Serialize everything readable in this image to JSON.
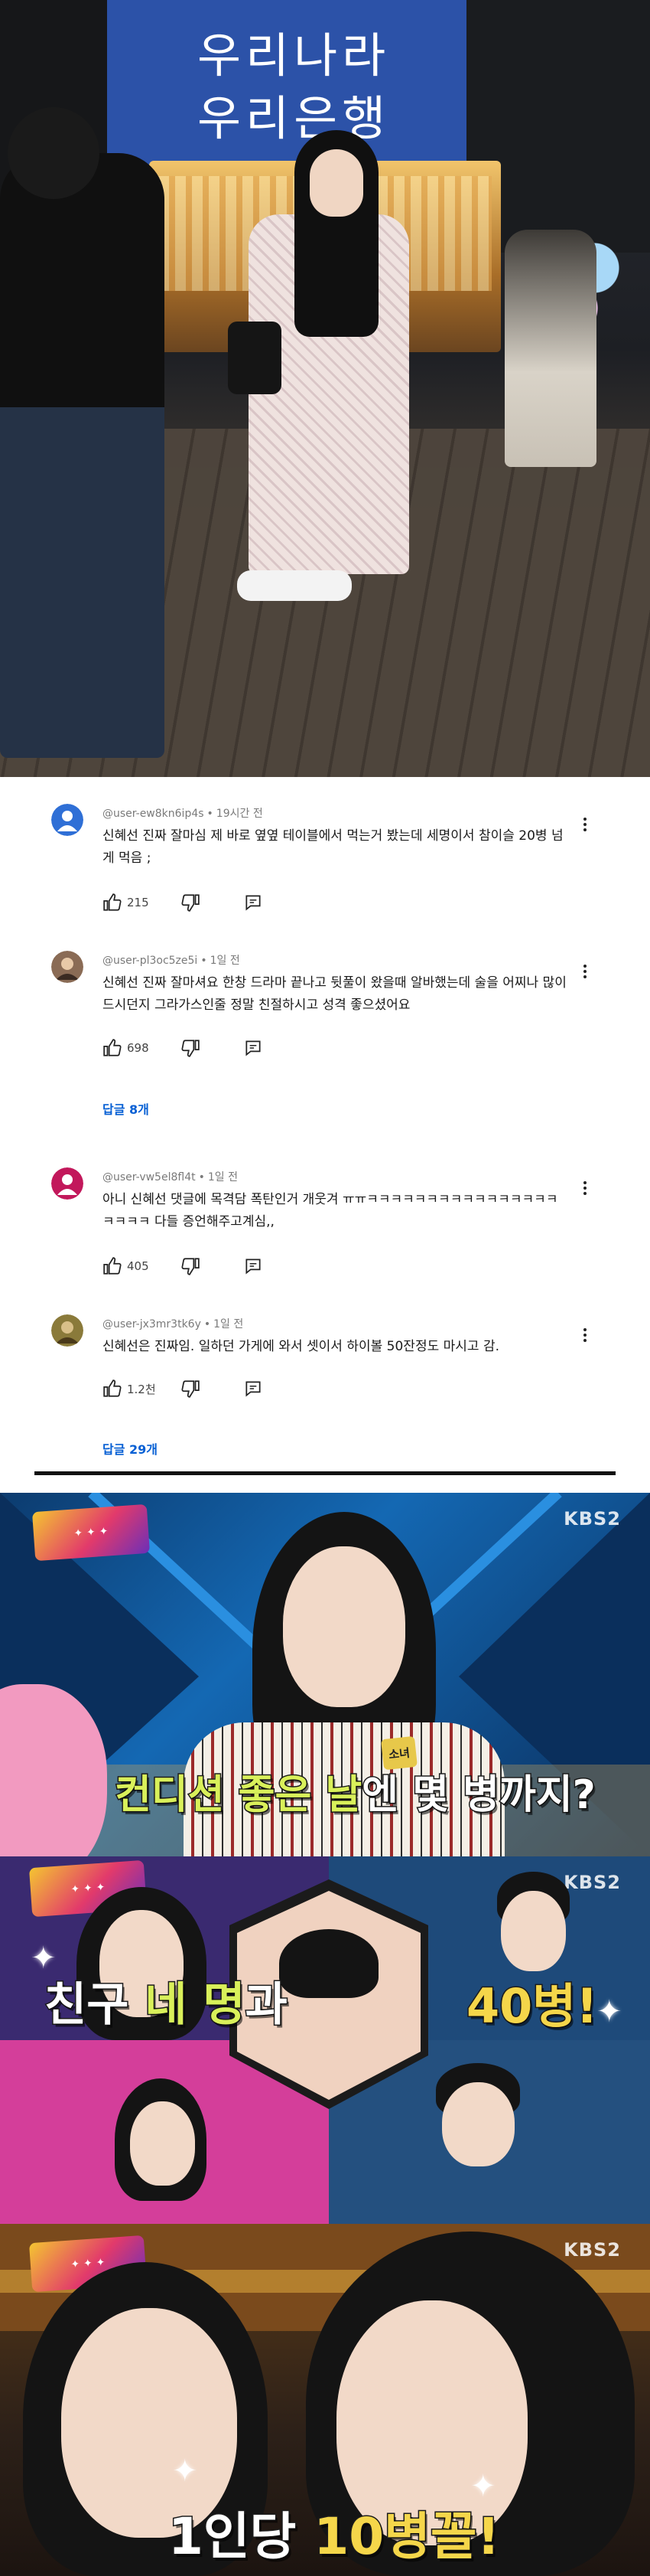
{
  "photo": {
    "sign_line1": "우리나라",
    "sign_line2": "우리은행"
  },
  "comments": [
    {
      "username": "@user-ew8kn6ip4s",
      "time": "19시간 전",
      "text": "신혜선 진짜 잘마심 제 바로 옆옆 테이블에서 먹는거 봤는데 세명이서 참이슬 20병 넘게 먹음 ;",
      "likes": "215",
      "avatar_color": "#2f6fd6",
      "replies_label": ""
    },
    {
      "username": "@user-pl3oc5ze5i",
      "time": "1일 전",
      "text": "신혜선 진짜 잘마셔요 한창 드라마 끝나고 뒷풀이 왔을때 알바했는데 술을 어찌나 많이드시던지 그라가스인줄 정말 친절하시고 성격 좋으셨어요",
      "likes": "698",
      "avatar_color": "#8a6b55",
      "replies_label": "답글 8개"
    },
    {
      "username": "@user-vw5el8fl4t",
      "time": "1일 전",
      "text": "아니 신혜선 댓글에 목격담 폭탄인거 개웃겨 ㅠㅠㅋㅋㅋㅋㅋㅋㅋㅋㅋㅋㅋㅋㅋㅋㅋㅋㅋㅋㅋㅋ 다들 증언해주고계심,,",
      "likes": "405",
      "avatar_color": "#c2185b",
      "replies_label": ""
    },
    {
      "username": "@user-jx3mr3tk6y",
      "time": "1일 전",
      "text": "신혜선은 진짜임. 일하던 가게에 와서 셋이서 하이볼 50잔정도 마시고 감.",
      "likes": "1.2천",
      "avatar_color": "#8a7a3a",
      "replies_label": "답글 29개"
    }
  ],
  "tv": {
    "broadcaster": "KBS2",
    "panel1_badge": "소녀",
    "panel1_caption_a": "컨디션 좋은 날",
    "panel1_caption_b": "엔 몇 병까지?",
    "panel2_caption_a": "친구 ",
    "panel2_caption_b": "네 명",
    "panel2_caption_c": "과",
    "panel2_caption_right": "40병!",
    "panel3_caption_a": "1인당 ",
    "panel3_caption_b": "10병꼴!"
  }
}
